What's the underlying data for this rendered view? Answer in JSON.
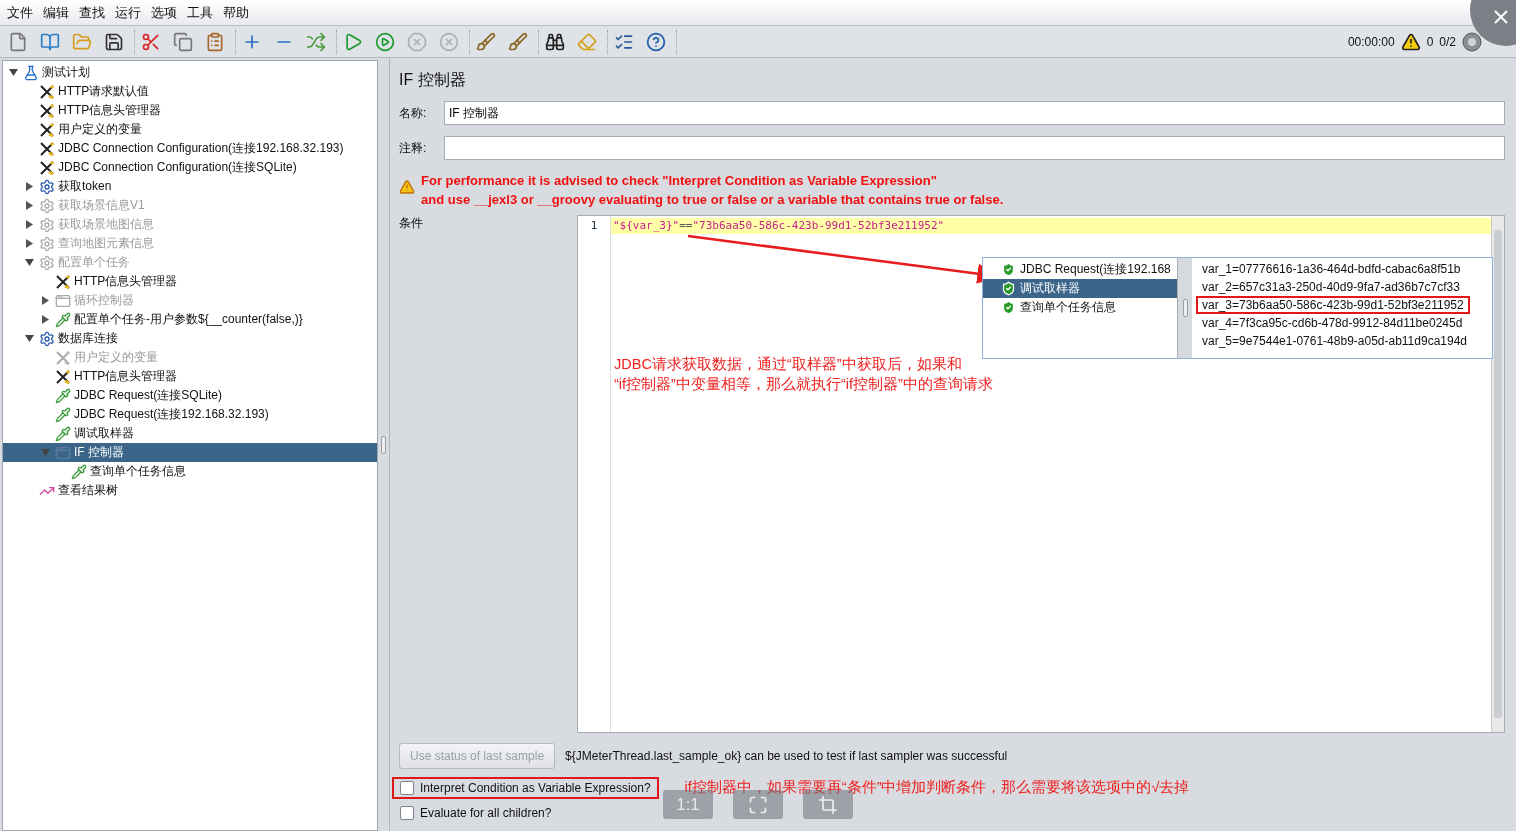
{
  "menu": [
    "文件",
    "编辑",
    "查找",
    "运行",
    "选项",
    "工具",
    "帮助"
  ],
  "toolbar": [
    {
      "buttons": [
        {
          "kind": "new",
          "disabled": false
        },
        {
          "kind": "templates",
          "disabled": false
        },
        {
          "kind": "open",
          "disabled": false
        },
        {
          "kind": "save",
          "disabled": false
        }
      ]
    },
    {
      "buttons": [
        {
          "kind": "cut",
          "disabled": false
        },
        {
          "kind": "copy",
          "disabled": false
        },
        {
          "kind": "paste",
          "disabled": false
        }
      ]
    },
    {
      "buttons": [
        {
          "kind": "expand",
          "disabled": false
        },
        {
          "kind": "collapse",
          "disabled": false
        },
        {
          "kind": "toggle",
          "disabled": false
        }
      ]
    },
    {
      "buttons": [
        {
          "kind": "start",
          "disabled": false
        },
        {
          "kind": "start_no_pause",
          "disabled": false
        },
        {
          "kind": "stop",
          "disabled": true
        },
        {
          "kind": "shutdown",
          "disabled": true
        }
      ]
    },
    {
      "buttons": [
        {
          "kind": "clear",
          "disabled": false
        },
        {
          "kind": "clear_all",
          "disabled": false
        }
      ]
    },
    {
      "buttons": [
        {
          "kind": "search",
          "disabled": false
        },
        {
          "kind": "reset_search",
          "disabled": false
        }
      ]
    },
    {
      "buttons": [
        {
          "kind": "functions",
          "disabled": false
        },
        {
          "kind": "help",
          "disabled": false
        }
      ]
    }
  ],
  "status": {
    "timer": "00:00:00",
    "warnings": "0",
    "threads": "0/2"
  },
  "tree": [
    {
      "label": "测试计划",
      "kind": "plan",
      "expanded": true,
      "disabled": false,
      "selected": false,
      "children": [
        {
          "label": "HTTP请求默认值",
          "kind": "config",
          "disabled": false,
          "selected": false
        },
        {
          "label": "HTTP信息头管理器",
          "kind": "config",
          "disabled": false,
          "selected": false
        },
        {
          "label": "用户定义的变量",
          "kind": "config",
          "disabled": false,
          "selected": false
        },
        {
          "label": "JDBC Connection Configuration(连接192.168.32.193)",
          "kind": "config",
          "disabled": false,
          "selected": false
        },
        {
          "label": "JDBC Connection Configuration(连接SQLite)",
          "kind": "config",
          "disabled": false,
          "selected": false
        },
        {
          "label": "获取token",
          "kind": "group",
          "expanded": false,
          "disabled": false,
          "selected": false
        },
        {
          "label": "获取场景信息V1",
          "kind": "group",
          "expanded": false,
          "disabled": true,
          "selected": false
        },
        {
          "label": "获取场景地图信息",
          "kind": "group",
          "expanded": false,
          "disabled": true,
          "selected": false
        },
        {
          "label": "查询地图元素信息",
          "kind": "group",
          "expanded": false,
          "disabled": true,
          "selected": false
        },
        {
          "label": "配置单个任务",
          "kind": "group",
          "expanded": true,
          "disabled": true,
          "selected": false,
          "children": [
            {
              "label": "HTTP信息头管理器",
              "kind": "config",
              "disabled": false,
              "selected": false
            },
            {
              "label": "循环控制器",
              "kind": "controller",
              "expanded": false,
              "disabled": true,
              "selected": false
            },
            {
              "label": "配置单个任务-用户参数${__counter(false,)}",
              "kind": "sampler",
              "expanded": false,
              "disabled": false,
              "selected": false
            }
          ]
        },
        {
          "label": "数据库连接",
          "kind": "group",
          "expanded": true,
          "disabled": false,
          "selected": false,
          "children": [
            {
              "label": "用户定义的变量",
              "kind": "config",
              "disabled": true,
              "selected": false
            },
            {
              "label": "HTTP信息头管理器",
              "kind": "config",
              "disabled": false,
              "selected": false
            },
            {
              "label": "JDBC Request(连接SQLite)",
              "kind": "sampler",
              "disabled": false,
              "selected": false
            },
            {
              "label": "JDBC Request(连接192.168.32.193)",
              "kind": "sampler",
              "disabled": false,
              "selected": false
            },
            {
              "label": "调试取样器",
              "kind": "sampler",
              "disabled": false,
              "selected": false
            },
            {
              "label": "IF 控制器",
              "kind": "controller",
              "expanded": true,
              "disabled": false,
              "selected": true,
              "children": [
                {
                  "label": "查询单个任务信息",
                  "kind": "sampler",
                  "disabled": false,
                  "selected": false
                }
              ]
            }
          ]
        },
        {
          "label": "查看结果树",
          "kind": "listener",
          "disabled": false,
          "selected": false
        }
      ]
    }
  ],
  "panel": {
    "title": "IF 控制器",
    "name_label": "名称:",
    "name_value": "IF 控制器",
    "comment_label": "注释:",
    "warning": [
      "For performance it is advised to check \"Interpret Condition as Variable Expression\"",
      "and use __jexl3 or __groovy evaluating to true or false or a variable that contains true or false."
    ],
    "condition_label": "条件",
    "code": {
      "line_number": "1",
      "tokens": [
        {
          "kind": "string",
          "text": "\"${var_3}\""
        },
        {
          "kind": "operator",
          "text": "=="
        },
        {
          "kind": "string",
          "text": "\"73b6aa50-586c-423b-99d1-52bf3e211952\""
        }
      ]
    },
    "last_sample_button": {
      "label": "Use status of last sample",
      "disabled": true
    },
    "hint": "${JMeterThread.last_sample_ok} can be used to test if last sampler was successful",
    "options": [
      {
        "label": "Interpret Condition as Variable Expression?",
        "checked": false,
        "outlined": true
      },
      {
        "label": "Evaluate for all children?",
        "checked": false,
        "outlined": false
      }
    ]
  },
  "inset_screenshot": {
    "samplers": [
      {
        "label": "JDBC Request(连接192.168",
        "selected": false
      },
      {
        "label": "调试取样器",
        "selected": true
      },
      {
        "label": "查询单个任务信息",
        "selected": false
      }
    ],
    "variables": [
      {
        "text": "var_1=07776616-1a36-464d-bdfd-cabac6a8f51b",
        "outlined": false
      },
      {
        "text": "var_2=657c31a3-250d-40d9-9fa7-ad36b7c7cf33",
        "outlined": false
      },
      {
        "text": "var_3=73b6aa50-586c-423b-99d1-52bf3e211952",
        "outlined": true
      },
      {
        "text": "var_4=7f3ca95c-cd6b-478d-9912-84d11be0245d",
        "outlined": false
      },
      {
        "text": "var_5=9e7544e1-0761-48b9-a05d-ab11d9ca194d",
        "outlined": false
      }
    ]
  },
  "annotations": {
    "editor_note": [
      "JDBC请求获取数据，通过“取样器”中获取后，如果和",
      "“if控制器”中变量相等，那么就执行“if控制器”中的查询请求"
    ],
    "option_note": "if控制器中，如果需要再“条件”中增加判断条件，那么需要将该选项中的√去掉"
  },
  "viewer_controls": {
    "actual_size": "1:1"
  }
}
